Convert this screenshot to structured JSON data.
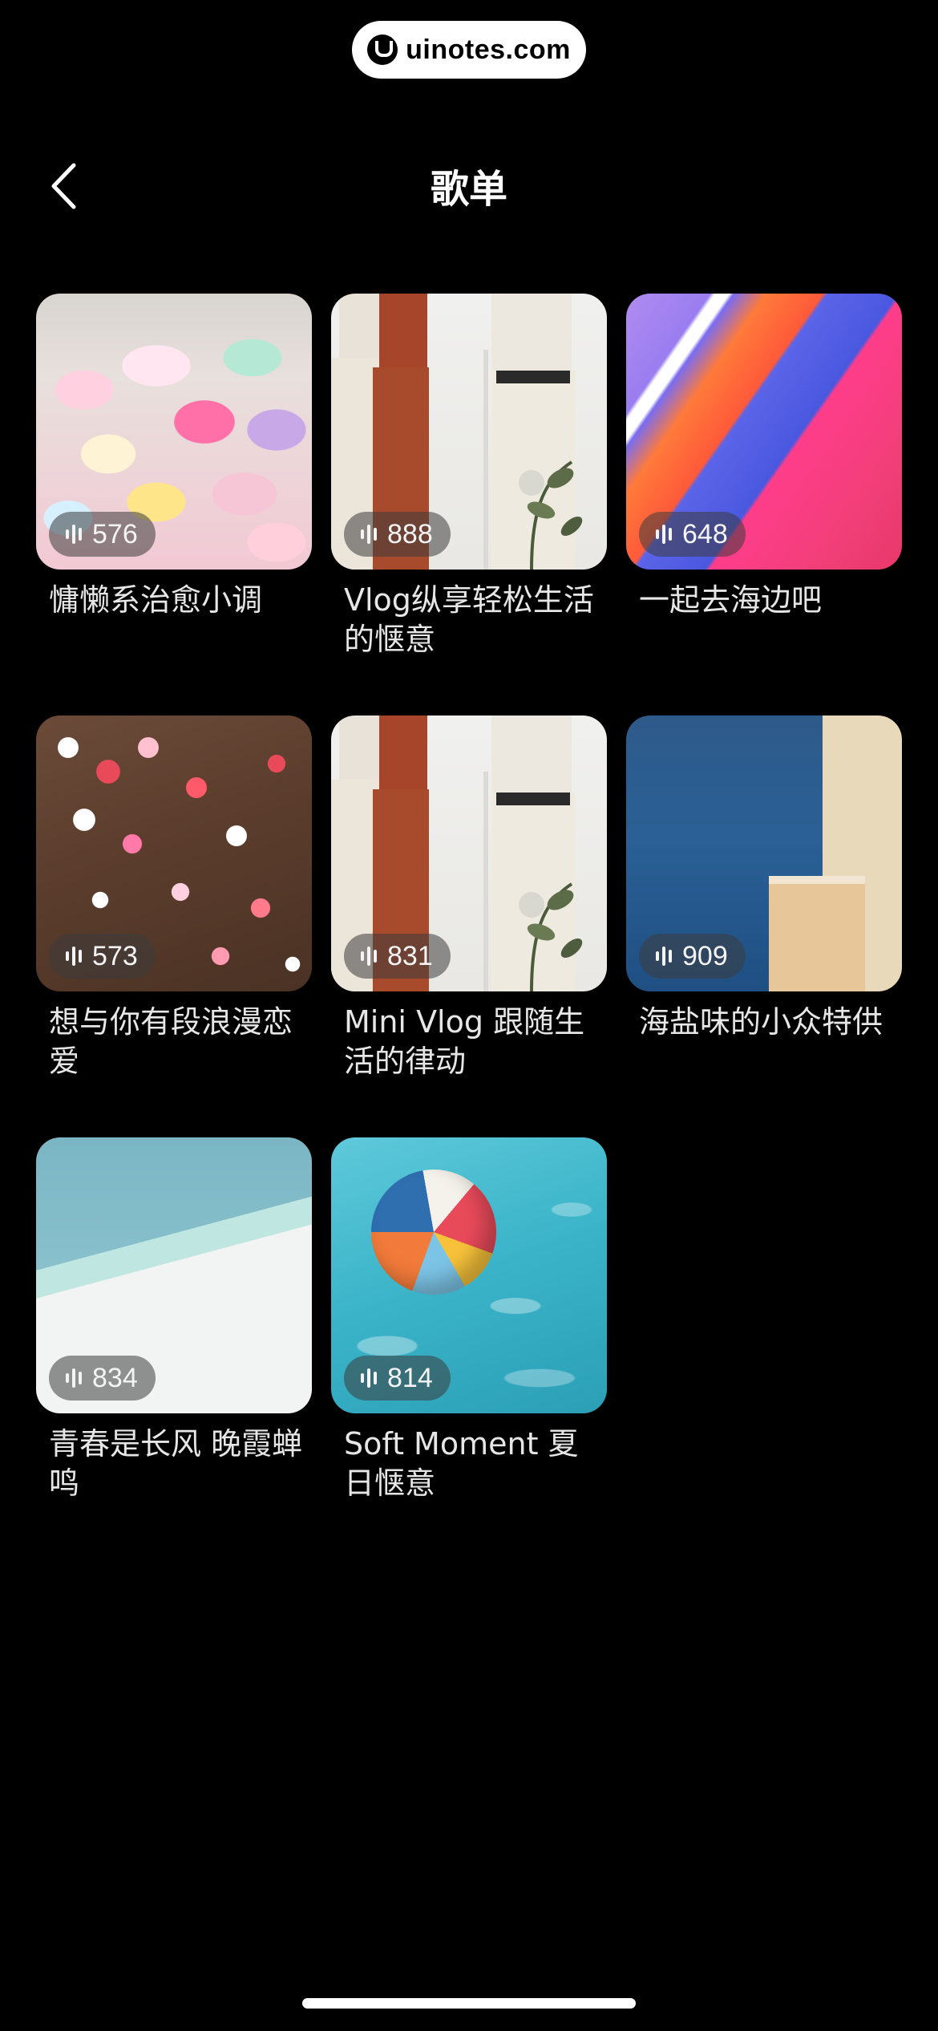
{
  "watermark": {
    "text": "uinotes.com"
  },
  "header": {
    "title": "歌单"
  },
  "playlists": [
    {
      "title": "慵懒系治愈小调",
      "count": "576",
      "art": "candy-hearts"
    },
    {
      "title": "Vlog纵享轻松生活的惬意",
      "count": "888",
      "art": "clothes-rack"
    },
    {
      "title": "一起去海边吧",
      "count": "648",
      "art": "color-stripes"
    },
    {
      "title": "想与你有段浪漫恋爱",
      "count": "573",
      "art": "hearts-on-wood"
    },
    {
      "title": "Mini Vlog 跟随生活的律动",
      "count": "831",
      "art": "clothes-rack"
    },
    {
      "title": "海盐味的小众特供",
      "count": "909",
      "art": "sea-balcony"
    },
    {
      "title": "青春是长风 晚霞蝉鸣",
      "count": "834",
      "art": "beach-bag"
    },
    {
      "title": "Soft Moment 夏日惬意",
      "count": "814",
      "art": "pool-ball"
    }
  ],
  "colors": {
    "background": "#000000",
    "text": "#e6e6e6",
    "pill": "#3c3c3c"
  }
}
